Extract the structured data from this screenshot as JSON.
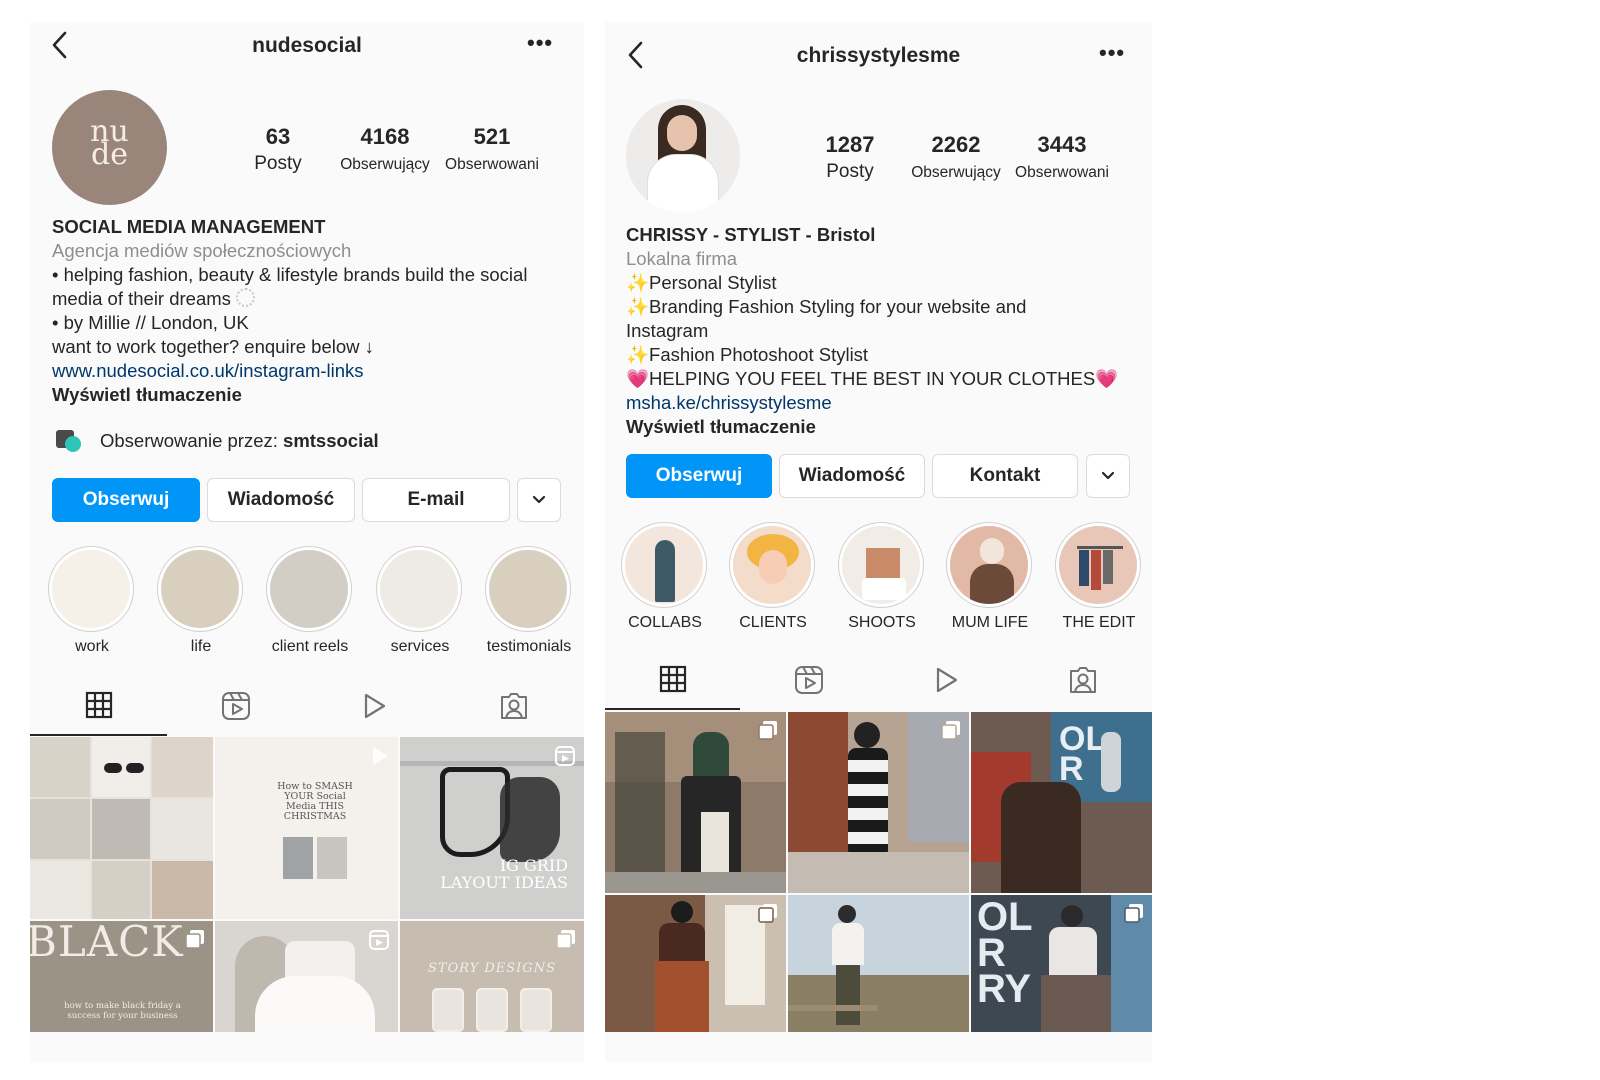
{
  "left_profile": {
    "header": {
      "username": "nudesocial"
    },
    "avatar": {
      "monogram_top": "nu",
      "monogram_bottom": "de",
      "color": "#9a857a"
    },
    "stats": [
      {
        "value": "63",
        "label": "Posty"
      },
      {
        "value": "4168",
        "label": "Obserwujący"
      },
      {
        "value": "521",
        "label": "Obserwowani"
      }
    ],
    "bio": {
      "name": "SOCIAL MEDIA MANAGEMENT",
      "category": "Agencja mediów społecznościowych",
      "line1": "• helping fashion, beauty & lifestyle brands build the social",
      "line2": "media of their dreams",
      "line3": "• by Millie // London, UK",
      "line4": "want to work together? enquire below ↓",
      "link": "www.nudesocial.co.uk/instagram-links",
      "translate": "Wyświetl tłumaczenie"
    },
    "followed_by": {
      "prefix": "Obserwowanie przez: ",
      "user": "smtssocial"
    },
    "buttons": {
      "follow": "Obserwuj",
      "message": "Wiadomość",
      "email": "E-mail"
    },
    "highlights": [
      {
        "label": "work",
        "color": "#f6f1e8"
      },
      {
        "label": "life",
        "color": "#d9cfbe"
      },
      {
        "label": "client reels",
        "color": "#d2cec5"
      },
      {
        "label": "services",
        "color": "#eeebe5"
      },
      {
        "label": "testimonials",
        "color": "#d8cfbf"
      }
    ],
    "posts": [
      {
        "kind": "collage",
        "text": ""
      },
      {
        "kind": "text",
        "text": "How to SMASH YOUR Social Media THIS CHRISTMAS"
      },
      {
        "kind": "text-dark",
        "text": "IG GRID LAYOUT IDEAS"
      },
      {
        "kind": "big",
        "text": "BLACK",
        "sub": "how to make black friday a success for your business"
      },
      {
        "kind": "photo",
        "text": ""
      },
      {
        "kind": "text",
        "text": "STORY DESIGNS"
      }
    ]
  },
  "right_profile": {
    "header": {
      "username": "chrissystylesme"
    },
    "stats": [
      {
        "value": "1287",
        "label": "Posty"
      },
      {
        "value": "2262",
        "label": "Obserwujący"
      },
      {
        "value": "3443",
        "label": "Obserwowani"
      }
    ],
    "bio": {
      "name": "CHRISSY - STYLIST - Bristol",
      "category": "Lokalna firma",
      "line1": "✨Personal Stylist",
      "line2": "✨Branding Fashion Styling for your website and",
      "line3": "Instagram",
      "line4": "✨Fashion Photoshoot Stylist",
      "line5": "💗HELPING YOU FEEL THE BEST IN YOUR CLOTHES💗",
      "link": "msha.ke/chrissystylesme",
      "translate": "Wyświetl tłumaczenie"
    },
    "buttons": {
      "follow": "Obserwuj",
      "message": "Wiadomość",
      "contact": "Kontakt"
    },
    "highlights": [
      {
        "label": "COLLABS",
        "color": "#f3e6dc"
      },
      {
        "label": "CLIENTS",
        "color": "#f4dccb"
      },
      {
        "label": "SHOOTS",
        "color": "#f1ece6"
      },
      {
        "label": "MUM LIFE",
        "color": "#e2b8a6"
      },
      {
        "label": "THE EDIT",
        "color": "#e8c7b9"
      }
    ]
  },
  "theme": {
    "accent": "#0095f6",
    "link": "#00376b",
    "muted": "#8e8e8e"
  }
}
